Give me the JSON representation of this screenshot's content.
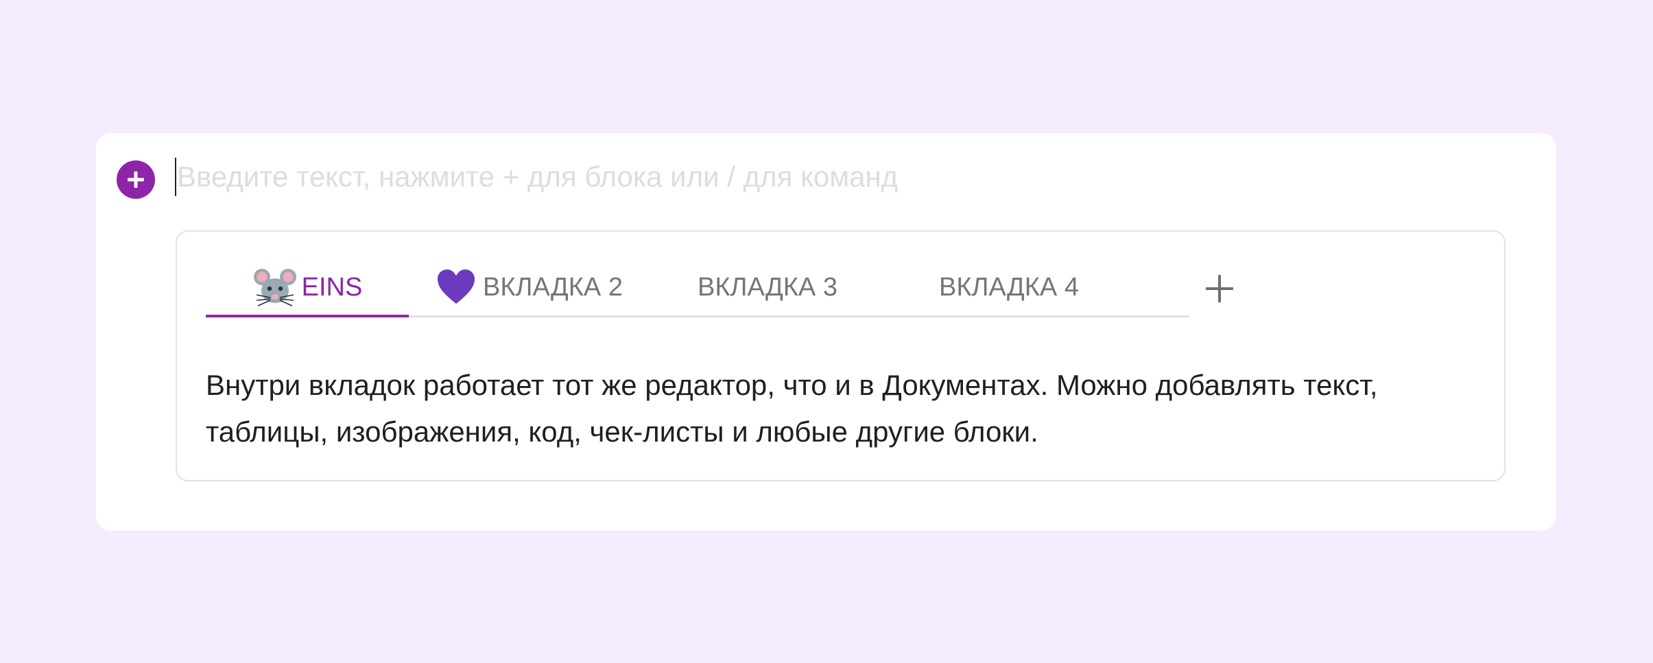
{
  "editor": {
    "placeholder": "Введите текст, нажмите + для блока или / для команд",
    "add_block_icon": "plus-circle-icon"
  },
  "tabs_block": {
    "tabs": [
      {
        "label": "EINS",
        "icon": "mouse-face-emoji",
        "active": true
      },
      {
        "label": "ВКЛАДКА 2",
        "icon": "purple-heart-emoji",
        "active": false
      },
      {
        "label": "ВКЛАДКА 3",
        "icon": null,
        "active": false
      },
      {
        "label": "ВКЛАДКА 4",
        "icon": null,
        "active": false
      }
    ],
    "add_tab_icon": "plus-icon",
    "content": "Внутри вкладок работает тот же редактор, что и в Документах. Можно добавлять текст, таблицы, изображения, код, чек-листы и любые другие блоки."
  },
  "colors": {
    "background": "#f4ebfe",
    "accent": "#8e24aa",
    "tab_inactive": "#757575",
    "placeholder": "#dcdce2"
  }
}
